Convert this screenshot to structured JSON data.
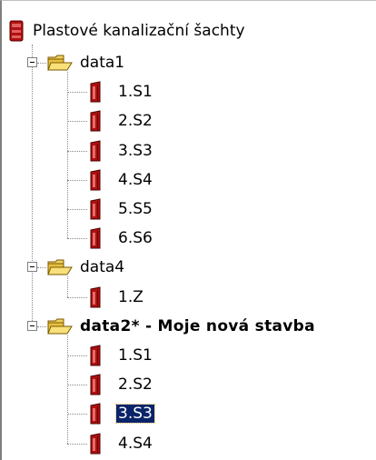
{
  "tree": {
    "root": {
      "label": "Plastové kanalizační šachty",
      "icon": "manhole-root-icon"
    },
    "groups": [
      {
        "label": "data1",
        "bold": false,
        "icon": "open-folder-icon",
        "items": [
          {
            "label": "1.S1",
            "icon": "manhole-shaft-icon"
          },
          {
            "label": "2.S2",
            "icon": "manhole-shaft-icon"
          },
          {
            "label": "3.S3",
            "icon": "manhole-shaft-icon"
          },
          {
            "label": "4.S4",
            "icon": "manhole-shaft-icon"
          },
          {
            "label": "5.S5",
            "icon": "manhole-shaft-icon"
          },
          {
            "label": "6.S6",
            "icon": "manhole-shaft-icon"
          }
        ]
      },
      {
        "label": "data4",
        "bold": false,
        "icon": "open-folder-icon",
        "items": [
          {
            "label": "1.Z",
            "icon": "manhole-shaft-icon"
          }
        ]
      },
      {
        "label": "data2* - Moje nová stavba",
        "bold": true,
        "icon": "open-folder-icon",
        "items": [
          {
            "label": "1.S1",
            "icon": "manhole-shaft-icon"
          },
          {
            "label": "2.S2",
            "icon": "manhole-shaft-icon"
          },
          {
            "label": "3.S3",
            "icon": "manhole-shaft-icon",
            "selected": true
          },
          {
            "label": "4.S4",
            "icon": "manhole-shaft-icon"
          }
        ]
      }
    ],
    "colors": {
      "selection_bg": "#0a246a",
      "shaft_red": "#b01010",
      "folder_yellow": "#f0d060"
    }
  }
}
